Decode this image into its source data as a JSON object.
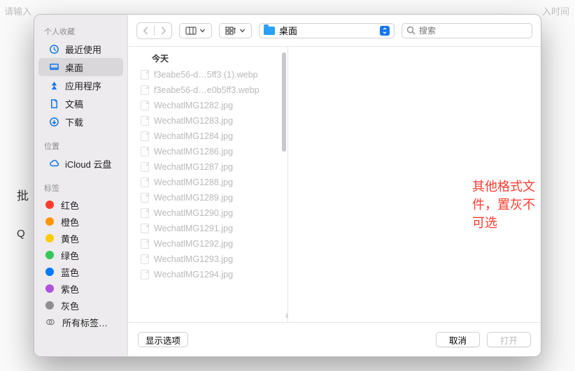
{
  "bg": {
    "input_placeholder": "请输入",
    "time_label": "入时间",
    "left_char": "批",
    "q_char": "Q"
  },
  "sidebar": {
    "favorites_label": "个人收藏",
    "items": [
      {
        "label": "最近使用"
      },
      {
        "label": "桌面"
      },
      {
        "label": "应用程序"
      },
      {
        "label": "文稿"
      },
      {
        "label": "下载"
      }
    ],
    "locations_label": "位置",
    "icloud_label": "iCloud 云盘",
    "tags_label": "标签",
    "tags": [
      {
        "label": "红色",
        "color": "#ff3b30"
      },
      {
        "label": "橙色",
        "color": "#ff9500"
      },
      {
        "label": "黄色",
        "color": "#ffcc00"
      },
      {
        "label": "绿色",
        "color": "#34c759"
      },
      {
        "label": "蓝色",
        "color": "#007aff"
      },
      {
        "label": "紫色",
        "color": "#af52de"
      },
      {
        "label": "灰色",
        "color": "#8e8e93"
      }
    ],
    "all_tags_label": "所有标签…"
  },
  "toolbar": {
    "path_label": "桌面",
    "search_placeholder": "搜索"
  },
  "list": {
    "group_label": "今天",
    "files": [
      "f3eabe56-d…5ff3 (1).webp",
      "f3eabe56-d…e0b5ff3.webp",
      "WechatlMG1282.jpg",
      "WechatlMG1283.jpg",
      "WechatlMG1284.jpg",
      "WechatlMG1286.jpg",
      "WechatlMG1287.jpg",
      "WechatlMG1288.jpg",
      "WechatlMG1289.jpg",
      "WechatlMG1290.jpg",
      "WechatlMG1291.jpg",
      "WechatlMG1292.jpg",
      "WechatlMG1293.jpg",
      "WechatlMG1294.jpg"
    ]
  },
  "annotation": "其他格式文件，置灰不可选",
  "footer": {
    "options": "显示选项",
    "cancel": "取消",
    "open": "打开"
  }
}
